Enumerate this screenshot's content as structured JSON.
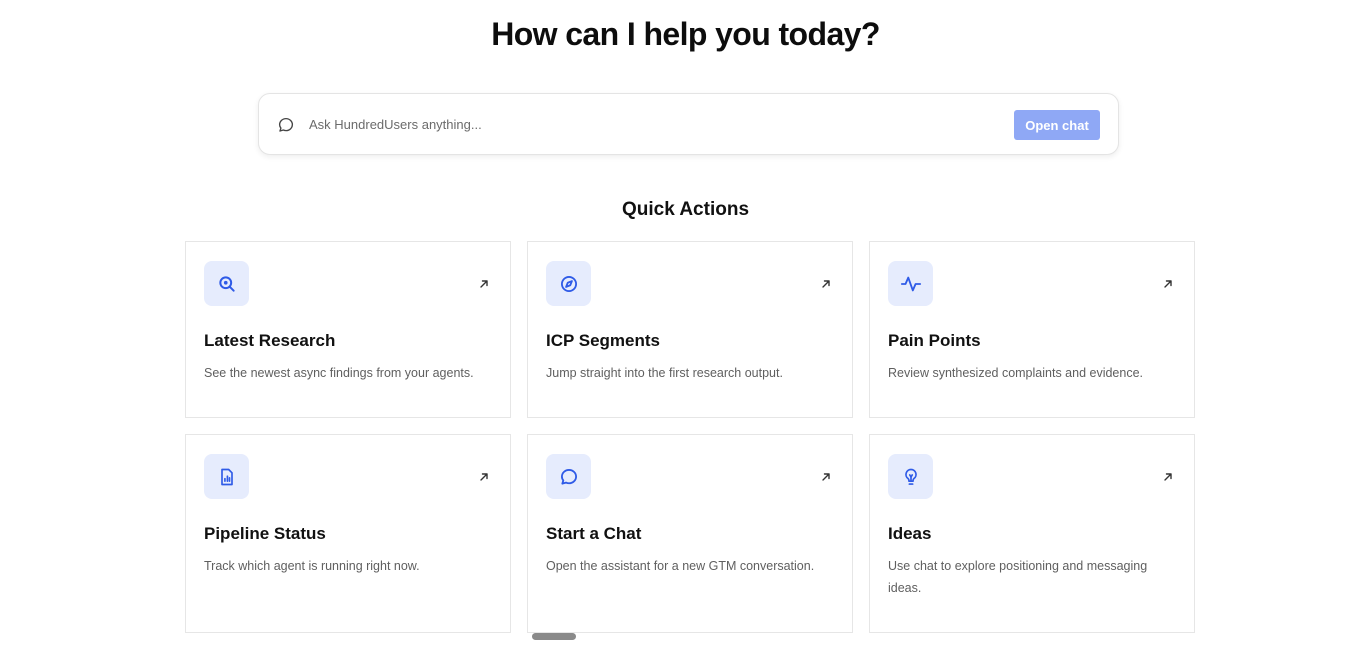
{
  "header": {
    "title": "How can I help you today?"
  },
  "search": {
    "placeholder": "Ask HundredUsers anything...",
    "value": "",
    "button_label": "Open chat",
    "icon": "chat-bubble-icon"
  },
  "quick_actions": {
    "title": "Quick Actions",
    "cards": [
      {
        "title": "Latest Research",
        "description": "See the newest async findings from your agents.",
        "icon": "search-magnify-icon"
      },
      {
        "title": "ICP Segments",
        "description": "Jump straight into the first research output.",
        "icon": "compass-icon"
      },
      {
        "title": "Pain Points",
        "description": "Review synthesized complaints and evidence.",
        "icon": "activity-pulse-icon"
      },
      {
        "title": "Pipeline Status",
        "description": "Track which agent is running right now.",
        "icon": "report-chart-icon"
      },
      {
        "title": "Start a Chat",
        "description": "Open the assistant for a new GTM conversation.",
        "icon": "chat-bubble-icon"
      },
      {
        "title": "Ideas",
        "description": "Use chat to explore positioning and messaging ideas.",
        "icon": "lightbulb-icon"
      }
    ]
  },
  "colors": {
    "accent": "#2f5be7",
    "button_bg": "#8fa8f5",
    "icon_bg": "#e6ecfd",
    "border": "#e6e6e6"
  }
}
